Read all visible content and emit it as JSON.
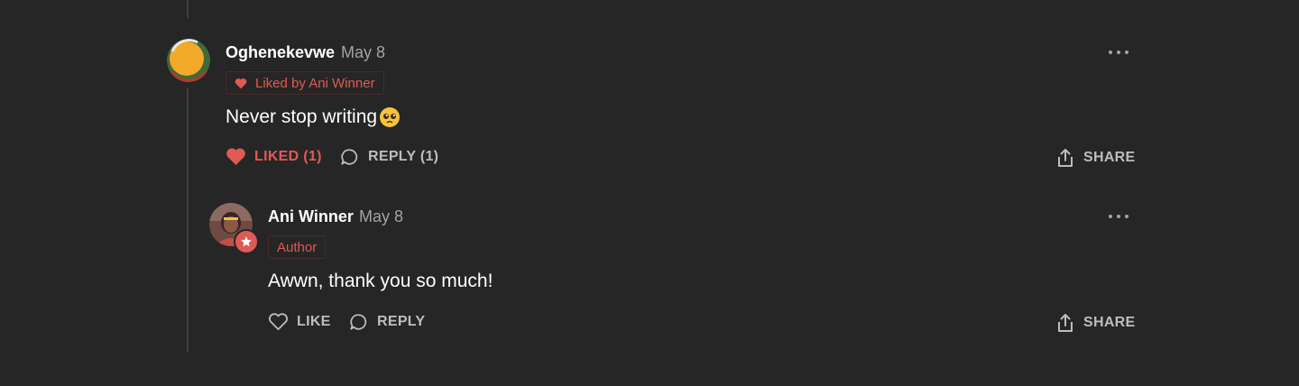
{
  "comment": {
    "author": "Oghenekevwe",
    "date": "May 8",
    "liked_badge": "Liked by Ani Winner",
    "text": "Never stop writing",
    "emoji": "🥺",
    "like_label": "LIKED (1)",
    "reply_label": "REPLY (1)",
    "share_label": "SHARE"
  },
  "reply": {
    "author": "Ani Winner",
    "date": "May 8",
    "author_badge": "Author",
    "text": "Awwn, thank you so much!",
    "like_label": "LIKE",
    "reply_label": "REPLY",
    "share_label": "SHARE"
  },
  "icons": {
    "heart_filled": "heart-filled-icon",
    "heart_outline": "heart-outline-icon",
    "reply": "speech-bubble-icon",
    "share": "share-icon",
    "more": "ellipsis-icon",
    "author_star": "star-icon"
  },
  "colors": {
    "background": "#262626",
    "accent": "#e05a55",
    "muted_text": "#a3a3a3",
    "action_text": "#bdbdbd"
  }
}
